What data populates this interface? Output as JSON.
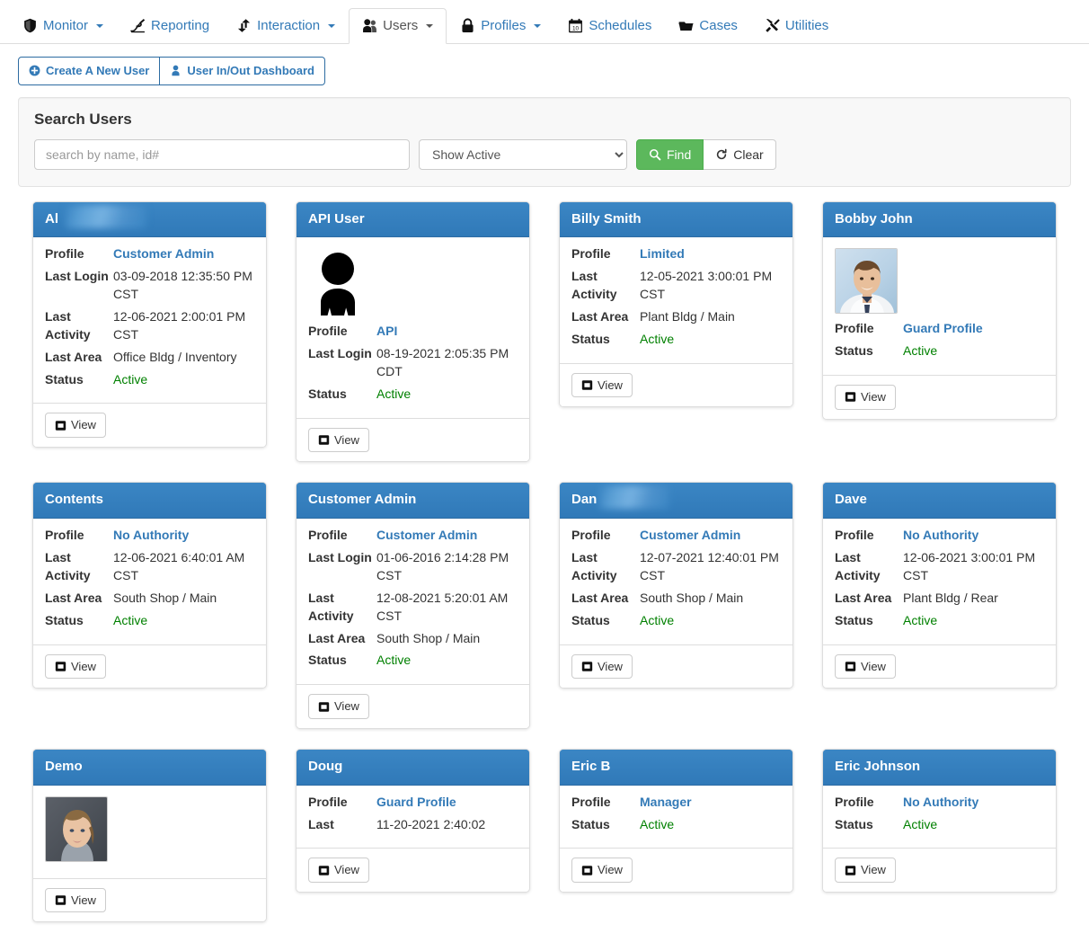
{
  "nav": {
    "tabs": [
      {
        "label": "Monitor",
        "icon": "shield-icon",
        "caret": true,
        "active": false
      },
      {
        "label": "Reporting",
        "icon": "signature-icon",
        "caret": false,
        "active": false
      },
      {
        "label": "Interaction",
        "icon": "exchange-icon",
        "caret": true,
        "active": false
      },
      {
        "label": "Users",
        "icon": "users-icon",
        "caret": true,
        "active": true
      },
      {
        "label": "Profiles",
        "icon": "lock-icon",
        "caret": true,
        "active": false
      },
      {
        "label": "Schedules",
        "icon": "calendar-icon",
        "caret": false,
        "active": false
      },
      {
        "label": "Cases",
        "icon": "folder-icon",
        "caret": false,
        "active": false
      },
      {
        "label": "Utilities",
        "icon": "tools-icon",
        "caret": false,
        "active": false
      }
    ]
  },
  "actions": {
    "create_user_label": "Create A New User",
    "dashboard_label": "User In/Out Dashboard"
  },
  "search": {
    "title": "Search Users",
    "placeholder": "search by name, id#",
    "value": "",
    "filter_selected": "Show Active",
    "filter_options": [
      "Show Active"
    ],
    "find_label": "Find",
    "clear_label": "Clear"
  },
  "labels": {
    "profile": "Profile",
    "last_login": "Last Login",
    "last_activity": "Last Activity",
    "last_area": "Last Area",
    "status": "Status",
    "view": "View"
  },
  "colors": {
    "card_header": "#337ab7",
    "link": "#337ab7",
    "status_active": "#008000",
    "find_button": "#5cb85c"
  },
  "cards": [
    {
      "name": "Al",
      "redacted_suffix": true,
      "redacted_width": 90,
      "avatar": "none",
      "fields": [
        {
          "label": "Profile",
          "value": "Customer Admin",
          "style": "link"
        },
        {
          "label": "Last Login",
          "value": "03-09-2018 12:35:50 PM CST",
          "style": "plain"
        },
        {
          "label": "Last Activity",
          "value": "12-06-2021 2:00:01 PM CST",
          "style": "plain"
        },
        {
          "label": "Last Area",
          "value": "Office Bldg / Inventory",
          "style": "plain"
        },
        {
          "label": "Status",
          "value": "Active",
          "style": "active"
        }
      ],
      "view_label": "View"
    },
    {
      "name": "API User",
      "redacted_suffix": false,
      "avatar": "silhouette",
      "fields": [
        {
          "label": "Profile",
          "value": "API",
          "style": "link"
        },
        {
          "label": "Last Login",
          "value": "08-19-2021 2:05:35 PM CDT",
          "style": "plain"
        },
        {
          "label": "Status",
          "value": "Active",
          "style": "active"
        }
      ],
      "view_label": "View"
    },
    {
      "name": "Billy Smith",
      "redacted_suffix": false,
      "avatar": "none",
      "fields": [
        {
          "label": "Profile",
          "value": "Limited",
          "style": "link"
        },
        {
          "label": "Last Activity",
          "value": "12-05-2021 3:00:01 PM CST",
          "style": "plain"
        },
        {
          "label": "Last Area",
          "value": "Plant Bldg / Main",
          "style": "plain"
        },
        {
          "label": "Status",
          "value": "Active",
          "style": "active"
        }
      ],
      "view_label": "View"
    },
    {
      "name": "Bobby John",
      "redacted_suffix": false,
      "avatar": "photo-male",
      "fields": [
        {
          "label": "Profile",
          "value": "Guard Profile",
          "style": "link"
        },
        {
          "label": "Status",
          "value": "Active",
          "style": "active"
        }
      ],
      "view_label": "View"
    },
    {
      "name": "Contents",
      "redacted_suffix": false,
      "avatar": "none",
      "fields": [
        {
          "label": "Profile",
          "value": "No Authority",
          "style": "link"
        },
        {
          "label": "Last Activity",
          "value": "12-06-2021 6:40:01 AM CST",
          "style": "plain"
        },
        {
          "label": "Last Area",
          "value": "South Shop / Main",
          "style": "plain"
        },
        {
          "label": "Status",
          "value": "Active",
          "style": "active"
        }
      ],
      "view_label": "View"
    },
    {
      "name": "Customer Admin",
      "redacted_suffix": false,
      "avatar": "none",
      "fields": [
        {
          "label": "Profile",
          "value": "Customer Admin",
          "style": "link"
        },
        {
          "label": "Last Login",
          "value": "01-06-2016 2:14:28 PM CST",
          "style": "plain"
        },
        {
          "label": "Last Activity",
          "value": "12-08-2021 5:20:01 AM CST",
          "style": "plain"
        },
        {
          "label": "Last Area",
          "value": "South Shop / Main",
          "style": "plain"
        },
        {
          "label": "Status",
          "value": "Active",
          "style": "active"
        }
      ],
      "view_label": "View"
    },
    {
      "name": "Dan",
      "redacted_suffix": true,
      "redacted_width": 78,
      "avatar": "none",
      "fields": [
        {
          "label": "Profile",
          "value": "Customer Admin",
          "style": "link"
        },
        {
          "label": "Last Activity",
          "value": "12-07-2021 12:40:01 PM CST",
          "style": "plain"
        },
        {
          "label": "Last Area",
          "value": "South Shop / Main",
          "style": "plain"
        },
        {
          "label": "Status",
          "value": "Active",
          "style": "active"
        }
      ],
      "view_label": "View"
    },
    {
      "name": "Dave",
      "redacted_suffix": false,
      "avatar": "none",
      "fields": [
        {
          "label": "Profile",
          "value": "No Authority",
          "style": "link"
        },
        {
          "label": "Last Activity",
          "value": "12-06-2021 3:00:01 PM CST",
          "style": "plain"
        },
        {
          "label": "Last Area",
          "value": "Plant Bldg / Rear",
          "style": "plain"
        },
        {
          "label": "Status",
          "value": "Active",
          "style": "active"
        }
      ],
      "view_label": "View"
    },
    {
      "name": "Demo",
      "redacted_suffix": false,
      "avatar": "photo-female",
      "fields": [],
      "view_label": "View"
    },
    {
      "name": "Doug",
      "redacted_suffix": false,
      "avatar": "none",
      "fields": [
        {
          "label": "Profile",
          "value": "Guard Profile",
          "style": "link"
        },
        {
          "label": "Last",
          "value": "11-20-2021 2:40:02",
          "style": "plain"
        }
      ],
      "view_label": "View"
    },
    {
      "name": "Eric B",
      "redacted_suffix": false,
      "avatar": "none",
      "fields": [
        {
          "label": "Profile",
          "value": "Manager",
          "style": "link"
        },
        {
          "label": "Status",
          "value": "Active",
          "style": "active"
        }
      ],
      "view_label": "View"
    },
    {
      "name": "Eric Johnson",
      "redacted_suffix": false,
      "avatar": "none",
      "fields": [
        {
          "label": "Profile",
          "value": "No Authority",
          "style": "link"
        },
        {
          "label": "Status",
          "value": "Active",
          "style": "active"
        }
      ],
      "view_label": "View"
    }
  ]
}
